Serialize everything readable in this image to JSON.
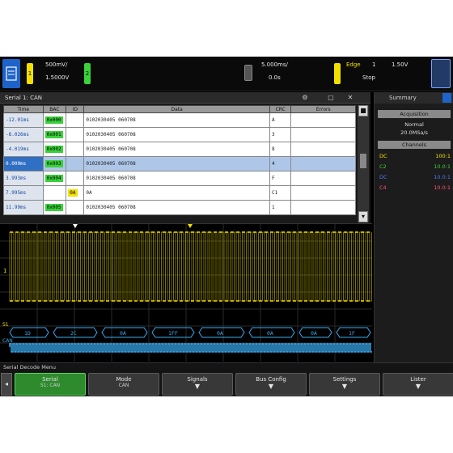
{
  "topbar": {
    "ch1_label": "1",
    "ch2_label": "2",
    "ch1_scale": "500mV/",
    "ch1_offset": "1.5000V",
    "time_scale": "5.000ms/",
    "time_delay": "0.0s",
    "trig_ch": "1",
    "trig_level": "1.50V",
    "trig_mode": "Stop",
    "trig_label": "Edge"
  },
  "lister": {
    "title": "Serial 1: CAN",
    "columns": [
      "Time",
      "BAC",
      "ID",
      "Data",
      "CRC",
      "Errors"
    ],
    "rows": [
      {
        "time": "-12.01ms",
        "bac": "0x000",
        "id": "",
        "data": "0102030405 060708",
        "crc": "A",
        "errors": "",
        "bac_color": "green"
      },
      {
        "time": "-8.026ms",
        "bac": "0x001",
        "id": "",
        "data": "0102030405 060708",
        "crc": "3",
        "errors": "",
        "bac_color": "green"
      },
      {
        "time": "-4.019ms",
        "bac": "0x002",
        "id": "",
        "data": "0102030405 060708",
        "crc": "8",
        "errors": "",
        "bac_color": "green"
      },
      {
        "time": "0.000ms",
        "bac": "0x003",
        "id": "",
        "data": "0102030405 060708",
        "crc": "4",
        "errors": "",
        "bac_color": "green",
        "selected": true
      },
      {
        "time": "3.993ms",
        "bac": "0x004",
        "id": "",
        "data": "0102030405 060708",
        "crc": "F",
        "errors": "",
        "bac_color": "green"
      },
      {
        "time": "7.995ms",
        "bac": "",
        "id": "0A",
        "data": "0A",
        "crc": "C1",
        "errors": "",
        "id_color": "yellow"
      },
      {
        "time": "11.99ms",
        "bac": "0x005",
        "id": "",
        "data": "0102030405 060708",
        "crc": "1",
        "errors": "",
        "bac_color": "green"
      }
    ]
  },
  "summary": {
    "title": "Summary",
    "acq_header": "Acquisition",
    "acq_mode": "Normal",
    "acq_rate": "20.0MSa/s",
    "channels_header": "Channels",
    "channels": [
      {
        "name": "DC",
        "value": "100:1",
        "color": "#f3e000"
      },
      {
        "name": "C2",
        "value": "10.0:1",
        "color": "#3ad13a"
      },
      {
        "name": "DC",
        "value": "10.0:1",
        "color": "#4a7bff"
      },
      {
        "name": "C4",
        "value": "10.0:1",
        "color": "#ff5577"
      }
    ]
  },
  "grid": {
    "ch1_marker": "1",
    "serial_label": "S1",
    "serial_sublabel": "CAN",
    "decode_labels": [
      "1D",
      "2C",
      "0A",
      "1FF",
      "0A",
      "0A",
      "0A",
      "1F"
    ]
  },
  "menu": {
    "title": "Serial Decode Menu",
    "back": "◂",
    "softkeys": [
      {
        "label": "Serial",
        "sub": "S1: CAN",
        "active": true
      },
      {
        "label": "Mode",
        "sub": "CAN",
        "active": false
      },
      {
        "label": "Signals",
        "sub": "",
        "active": false
      },
      {
        "label": "Bus Config",
        "sub": "",
        "active": false
      },
      {
        "label": "Settings",
        "sub": "",
        "active": false
      },
      {
        "label": "Lister",
        "sub": "",
        "active": false
      }
    ]
  },
  "colors": {
    "ch1": "#f3e000",
    "serial": "#3aaaf0",
    "accent_green": "#3ad13a"
  }
}
